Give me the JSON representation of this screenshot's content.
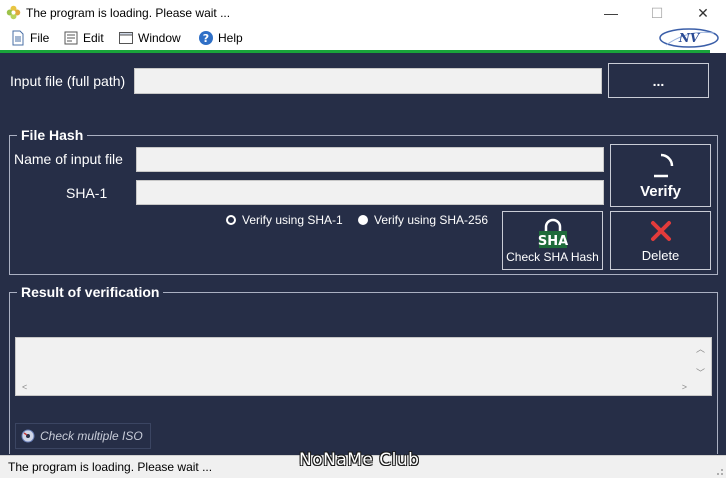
{
  "window": {
    "title": "The program is loading. Please wait ...",
    "app_icon": "flower-icon",
    "controls": {
      "minimize": "—",
      "maximize": "☐",
      "close": "✕"
    }
  },
  "menu": {
    "items": [
      {
        "label": "File",
        "icon": "file-icon"
      },
      {
        "label": "Edit",
        "icon": "edit-icon"
      },
      {
        "label": "Window",
        "icon": "window-icon"
      },
      {
        "label": "Help",
        "icon": "help-icon"
      }
    ],
    "logo_text": "NV"
  },
  "input_file": {
    "label": "Input file (full path)",
    "value": "",
    "browse_label": "..."
  },
  "file_hash": {
    "title": "File Hash",
    "name_label": "Name of input file",
    "name_value": "",
    "sha1_label": "SHA-1",
    "sha1_value": "",
    "verify_label": "Verify",
    "radio_sha1": "Verify using SHA-1",
    "radio_sha256": "Verify using SHA-256",
    "selected": "sha256",
    "check_sha_badge": "SHA",
    "check_sha_label": "Check SHA Hash",
    "delete_label": "Delete"
  },
  "result": {
    "title": "Result of verification",
    "value": ""
  },
  "multi_iso": {
    "label": "Check multiple ISO"
  },
  "status": {
    "text": "The program is loading. Please wait ..."
  },
  "watermark": "NoNaMe Club",
  "colors": {
    "background": "#262e47",
    "field": "#f1f1f1",
    "accent_green": "#19a33a",
    "delete_red": "#e23b3b"
  }
}
